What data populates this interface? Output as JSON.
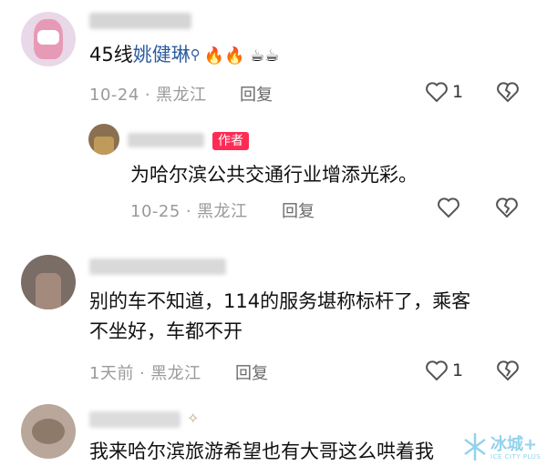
{
  "comments": [
    {
      "text_prefix": "45线",
      "link": "姚健琳",
      "emoji": "🔥🔥 ☕☕",
      "date": "10-24",
      "location": "黑龙江",
      "reply_label": "回复",
      "likes": "1"
    },
    {
      "author_tag": "作者",
      "text": "为哈尔滨公共交通行业增添光彩。",
      "date": "10-25",
      "location": "黑龙江",
      "reply_label": "回复"
    },
    {
      "text_line1": "别的车不知道，114的服务堪称标杆了，乘客",
      "text_line2": "不坐好，车都不开",
      "date": "1天前",
      "location": "黑龙江",
      "reply_label": "回复",
      "likes": "1"
    },
    {
      "text": "我来哈尔滨旅游希望也有大哥这么哄着我"
    }
  ],
  "watermark": {
    "brand": "冰城+",
    "sub": "ICE CITY PLUS"
  },
  "colors": {
    "author_tag": "#fe2c55",
    "link": "#2d5d9f",
    "meta": "#9a9a9a"
  }
}
